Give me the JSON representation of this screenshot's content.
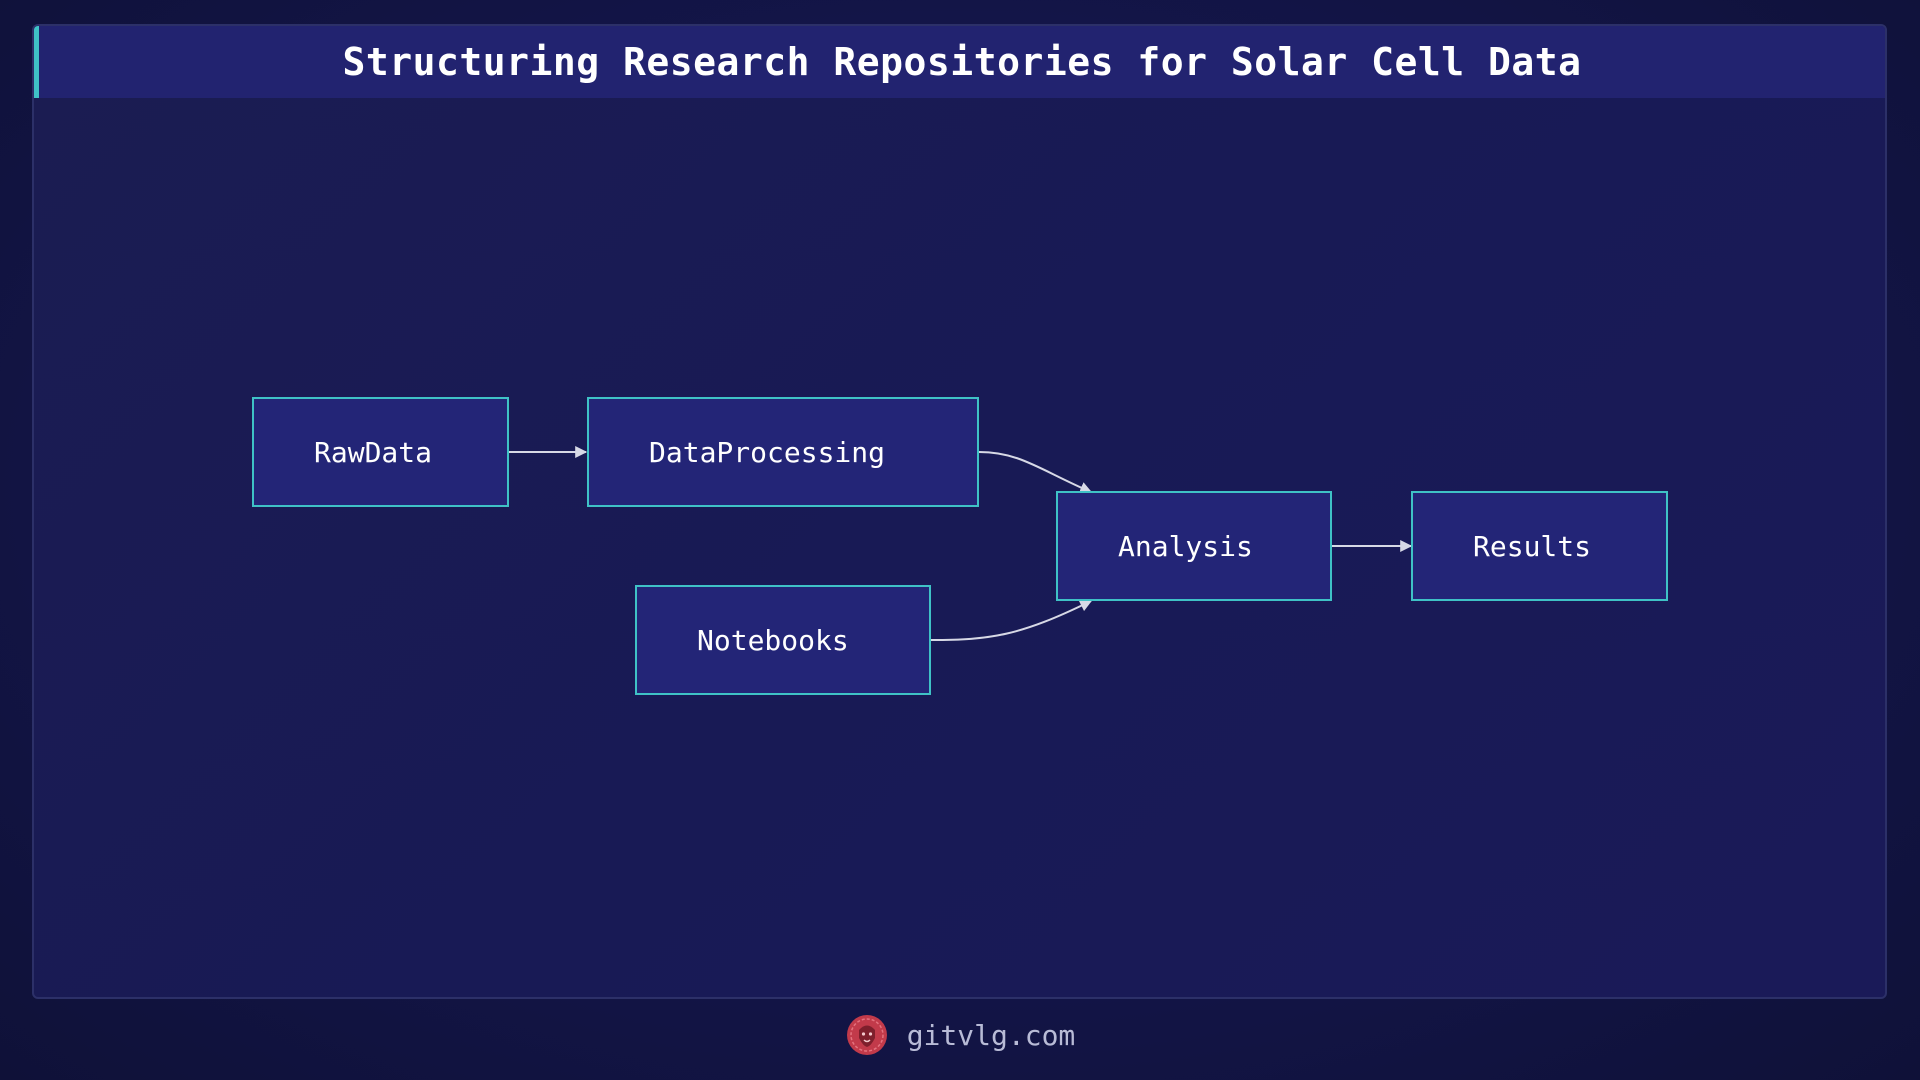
{
  "header": {
    "title": "Structuring Research Repositories for Solar Cell Data"
  },
  "diagram": {
    "nodes": {
      "raw_data": "RawData",
      "data_processing": "DataProcessing",
      "notebooks": "Notebooks",
      "analysis": "Analysis",
      "results": "Results"
    },
    "edges": [
      {
        "from": "RawData",
        "to": "DataProcessing"
      },
      {
        "from": "DataProcessing",
        "to": "Analysis"
      },
      {
        "from": "Notebooks",
        "to": "Analysis"
      },
      {
        "from": "Analysis",
        "to": "Results"
      }
    ]
  },
  "footer": {
    "site": "gitvlg.com",
    "logo_icon": "lion-logo-icon"
  },
  "colors": {
    "background": "#131548",
    "header": "#222370",
    "accent": "#3fc2c6",
    "node_fill": "#232577",
    "edge": "#d7d9e6",
    "logo": "#c23a4a"
  }
}
